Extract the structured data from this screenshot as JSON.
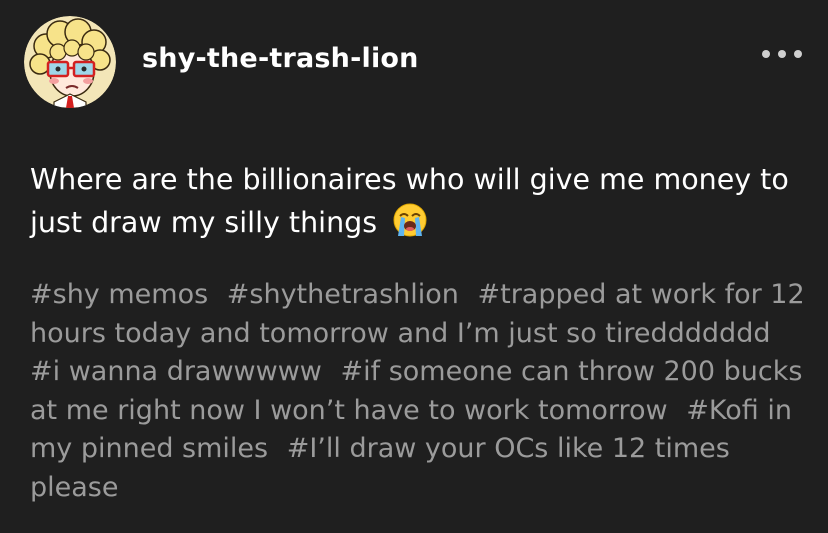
{
  "post": {
    "author": {
      "username": "shy-the-trash-lion",
      "avatar_icon": "avatar-illustration"
    },
    "more_icon": "more-horizontal-icon",
    "body_text": "Where are the billionaires who will give me money to just draw my silly things",
    "body_emoji": "loudly-crying-face-emoji",
    "tags": [
      "#shy memos",
      "#shythetrashlion",
      "#trapped at work for 12 hours today and tomorrow and I’m just so tireddddddd",
      "#i wanna drawwwww",
      "#if someone can throw 200 bucks at me right now I won’t have to work tomorrow",
      "#Kofi in my pinned smiles",
      "#I’ll draw your OCs like 12 times please"
    ]
  },
  "colors": {
    "background": "#1f1f1f",
    "text": "#ffffff",
    "tag_text": "#9b9b9b",
    "more_dots": "#cfcfcf"
  }
}
